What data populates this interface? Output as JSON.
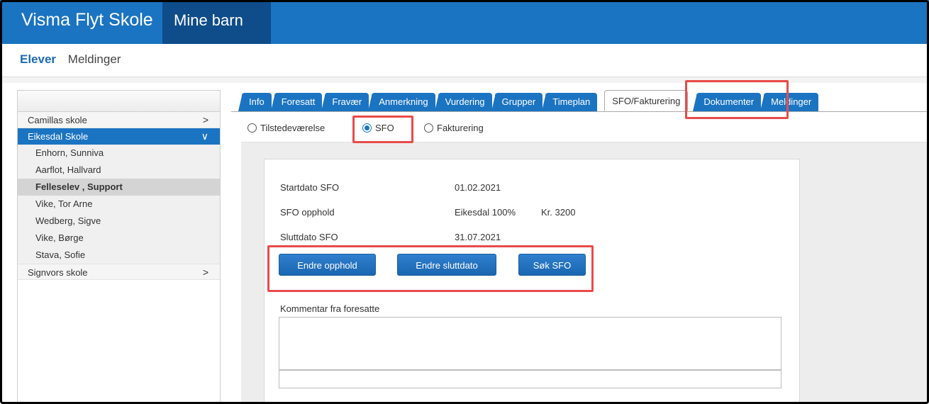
{
  "header": {
    "brand": "Visma Flyt Skole",
    "nav_active": "Mine barn"
  },
  "subnav": {
    "active": "Elever",
    "item": "Meldinger"
  },
  "sidebar": {
    "schools": [
      {
        "name": "Camillas skole",
        "chevron": ">"
      },
      {
        "name": "Eikesdal Skole",
        "chevron": "∨"
      },
      {
        "name": "Signvors skole",
        "chevron": ">"
      }
    ],
    "students": [
      "Enhorn, Sunniva",
      "Aarflot, Hallvard",
      "Felleselev , Support",
      "Vike, Tor Arne",
      "Wedberg, Sigve",
      "Vike, Børge",
      "Stava, Sofie"
    ],
    "selected_student": "Felleselev , Support"
  },
  "tabs": [
    "Info",
    "Foresatt",
    "Fravær",
    "Anmerkning",
    "Vurdering",
    "Grupper",
    "Timeplan",
    "SFO/Fakturering",
    "Dokumenter",
    "Meldinger"
  ],
  "active_tab": "SFO/Fakturering",
  "radios": {
    "options": [
      "Tilstedeværelse",
      "SFO",
      "Fakturering"
    ],
    "selected": "SFO"
  },
  "sfo": {
    "startdato_label": "Startdato SFO",
    "startdato_value": "01.02.2021",
    "opphold_label": "SFO opphold",
    "opphold_value": "Eikesdal 100%",
    "opphold_price": "Kr. 3200",
    "sluttdato_label": "Sluttdato SFO",
    "sluttdato_value": "31.07.2021"
  },
  "buttons": {
    "endre_opphold": "Endre opphold",
    "endre_sluttdato": "Endre sluttdato",
    "sok_sfo": "Søk SFO"
  },
  "comment": {
    "label": "Kommentar fra foresatte",
    "value": ""
  },
  "colors": {
    "primary": "#1b74c1",
    "primary_dark": "#0e4c8a",
    "highlight": "#e84b4b"
  }
}
